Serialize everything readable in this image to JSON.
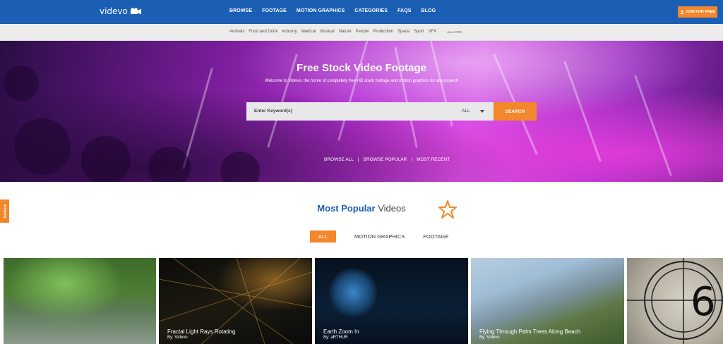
{
  "brand": {
    "logo_text": "videvo",
    "accent": "#f2872b",
    "nav_bg": "#1a5fb4"
  },
  "nav": {
    "items": [
      "BROWSE",
      "FOOTAGE",
      "MOTION GRAPHICS",
      "CATEGORIES",
      "FAQS",
      "BLOG"
    ],
    "join_label": "JOIN FOR FREE"
  },
  "categories": {
    "items": [
      "Animals",
      "Food and Drink",
      "Industry",
      "Medical",
      "Musical",
      "Nature",
      "People",
      "Production",
      "Space",
      "Sport",
      "VFX"
    ],
    "all_label": "ALL CATS"
  },
  "hero": {
    "title": "Free Stock Video Footage",
    "subtitle": "Welcome to Videvo, the home of completely free HD stock footage and motion graphics for any project!",
    "search_placeholder": "Enter Keyword(s)",
    "filter_value": "ALL",
    "search_label": "SEARCH",
    "links": [
      "BROWSE ALL",
      "BROWSE POPULAR",
      "MOST RECENT"
    ]
  },
  "feedback_label": "feedback",
  "popular": {
    "title_bold": "Most Popular",
    "title_light": "Videos",
    "tabs": [
      "ALL",
      "MOTION GRAPHICS",
      "FOOTAGE"
    ]
  },
  "videos": [
    {
      "title": "",
      "author": ""
    },
    {
      "title": "Fractal Light Rays Rotating",
      "author": "By: Videvo"
    },
    {
      "title": "Earth Zoom In",
      "author": "By: aRTHUR"
    },
    {
      "title": "Flying Through Palm Trees Along Beach",
      "author": "By: Videvo"
    },
    {
      "title": "",
      "author": "",
      "overlay_text": "6"
    }
  ]
}
